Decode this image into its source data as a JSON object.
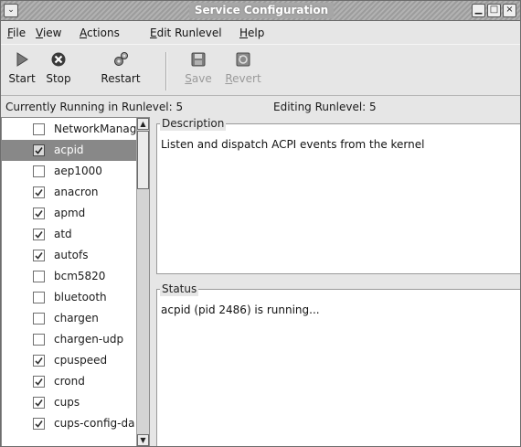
{
  "window": {
    "title": "Service Configuration",
    "menu_button_glyph": "⌄",
    "minimize_glyph": "▁",
    "maximize_glyph": "□",
    "close_glyph": "×"
  },
  "menubar": {
    "items": [
      {
        "mnemonic": "F",
        "rest": "ile"
      },
      {
        "mnemonic": "V",
        "rest": "iew"
      },
      {
        "mnemonic": "A",
        "rest": "ctions"
      },
      {
        "mnemonic": "E",
        "rest": "dit Runlevel"
      },
      {
        "mnemonic": "H",
        "rest": "elp"
      }
    ]
  },
  "toolbar": {
    "start": {
      "label": "Start",
      "icon": "play-icon"
    },
    "stop": {
      "label": "Stop",
      "icon": "stop-circle-icon"
    },
    "restart": {
      "label": "Restart",
      "icon": "restart-gears-icon"
    },
    "save": {
      "mnemonic": "S",
      "rest": "ave",
      "icon": "save-disk-icon",
      "enabled": false
    },
    "revert": {
      "mnemonic": "R",
      "rest": "evert",
      "icon": "revert-icon",
      "enabled": false
    }
  },
  "runlevel": {
    "current": "Currently Running in Runlevel: 5",
    "editing": "Editing Runlevel: 5"
  },
  "services": [
    {
      "name": "NetworkManag",
      "checked": false,
      "selected": false
    },
    {
      "name": "acpid",
      "checked": true,
      "selected": true
    },
    {
      "name": "aep1000",
      "checked": false,
      "selected": false
    },
    {
      "name": "anacron",
      "checked": true,
      "selected": false
    },
    {
      "name": "apmd",
      "checked": true,
      "selected": false
    },
    {
      "name": "atd",
      "checked": true,
      "selected": false
    },
    {
      "name": "autofs",
      "checked": true,
      "selected": false
    },
    {
      "name": "bcm5820",
      "checked": false,
      "selected": false
    },
    {
      "name": "bluetooth",
      "checked": false,
      "selected": false
    },
    {
      "name": "chargen",
      "checked": false,
      "selected": false
    },
    {
      "name": "chargen-udp",
      "checked": false,
      "selected": false
    },
    {
      "name": "cpuspeed",
      "checked": true,
      "selected": false
    },
    {
      "name": "crond",
      "checked": true,
      "selected": false
    },
    {
      "name": "cups",
      "checked": true,
      "selected": false
    },
    {
      "name": "cups-config-da",
      "checked": true,
      "selected": false
    }
  ],
  "scrollbar": {
    "up_glyph": "▲",
    "down_glyph": "▼"
  },
  "description": {
    "label": "Description",
    "text": "Listen and dispatch ACPI events from the kernel"
  },
  "status": {
    "label": "Status",
    "text": "acpid (pid 2486) is running..."
  },
  "colors": {
    "selection": "#888888",
    "titlebar": "#a6a6a6"
  }
}
